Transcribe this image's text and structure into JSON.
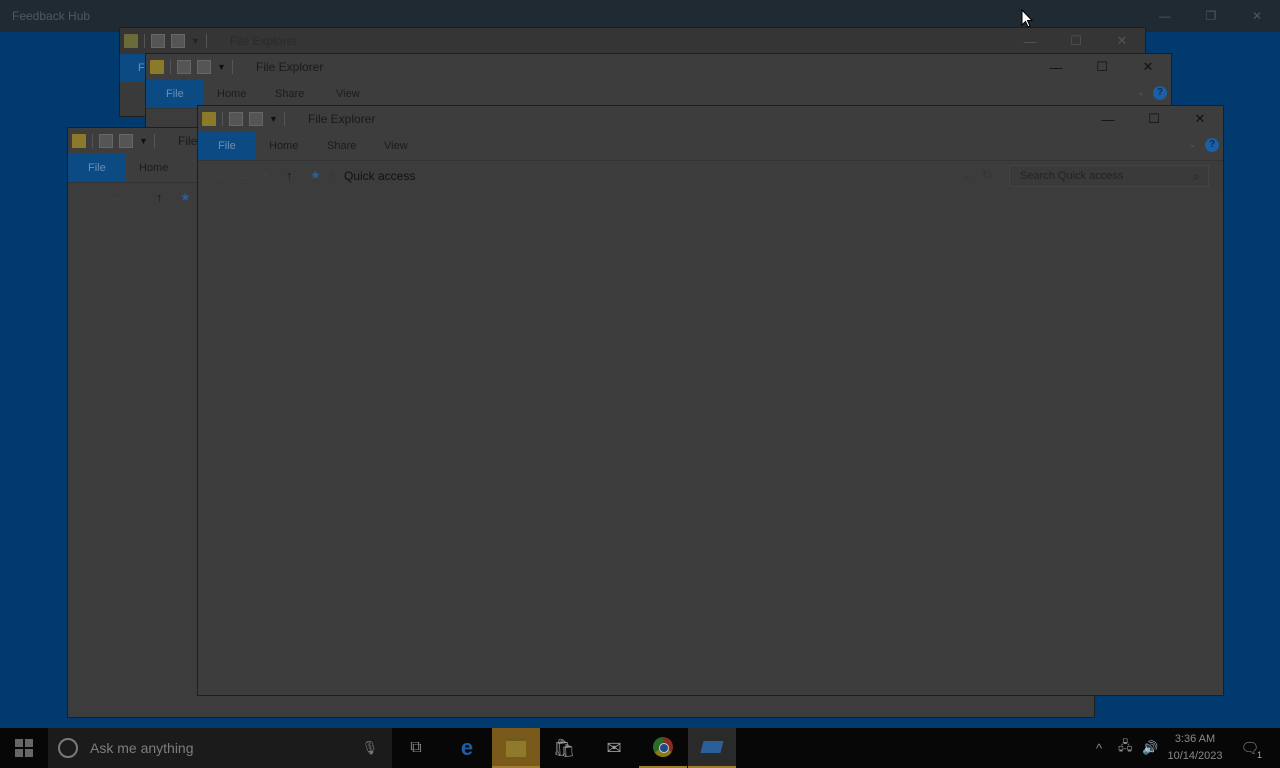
{
  "feedback_hub": {
    "title": "Feedback Hub",
    "minimize": "—",
    "restore": "❐",
    "close": "✕"
  },
  "windows": {
    "back": {
      "title": "File Explorer",
      "minimize": "—",
      "maximize": "☐",
      "close": "✕",
      "tab_file_letter": "F"
    },
    "middle": {
      "title": "File Explorer",
      "minimize": "—",
      "maximize": "☐",
      "close": "✕",
      "tabs": [
        "File",
        "Home",
        "Share",
        "View"
      ],
      "help": "?"
    },
    "left": {
      "title": "File",
      "tabs": [
        "File",
        "Home"
      ]
    },
    "front": {
      "title": "File Explorer",
      "minimize": "—",
      "maximize": "☐",
      "close": "✕",
      "tabs": [
        "File",
        "Home",
        "Share",
        "View"
      ],
      "help": "?",
      "address": {
        "back": "←",
        "forward": "→",
        "recent": "⌄",
        "up": "↑",
        "location": "Quick access",
        "dropdown": "⌄",
        "refresh": "↻"
      },
      "search": {
        "placeholder": "Search Quick access",
        "icon": "⌕"
      }
    }
  },
  "taskbar": {
    "search_placeholder": "Ask me anything",
    "mic_icon": "🎙",
    "apps": [
      {
        "name": "task-view",
        "glyph": "⧉"
      },
      {
        "name": "edge",
        "glyph": "e"
      },
      {
        "name": "file-explorer",
        "glyph": "▬"
      },
      {
        "name": "store",
        "glyph": "🛍"
      },
      {
        "name": "mail",
        "glyph": "✉"
      },
      {
        "name": "chrome",
        "glyph": "◉"
      },
      {
        "name": "feedback-hub",
        "glyph": "▰"
      }
    ],
    "tray": {
      "chevron": "^",
      "network": "🖧",
      "volume": "🔊",
      "time": "3:36 AM",
      "date": "10/14/2023",
      "notifications": "🗨",
      "notification_count": "1"
    }
  }
}
